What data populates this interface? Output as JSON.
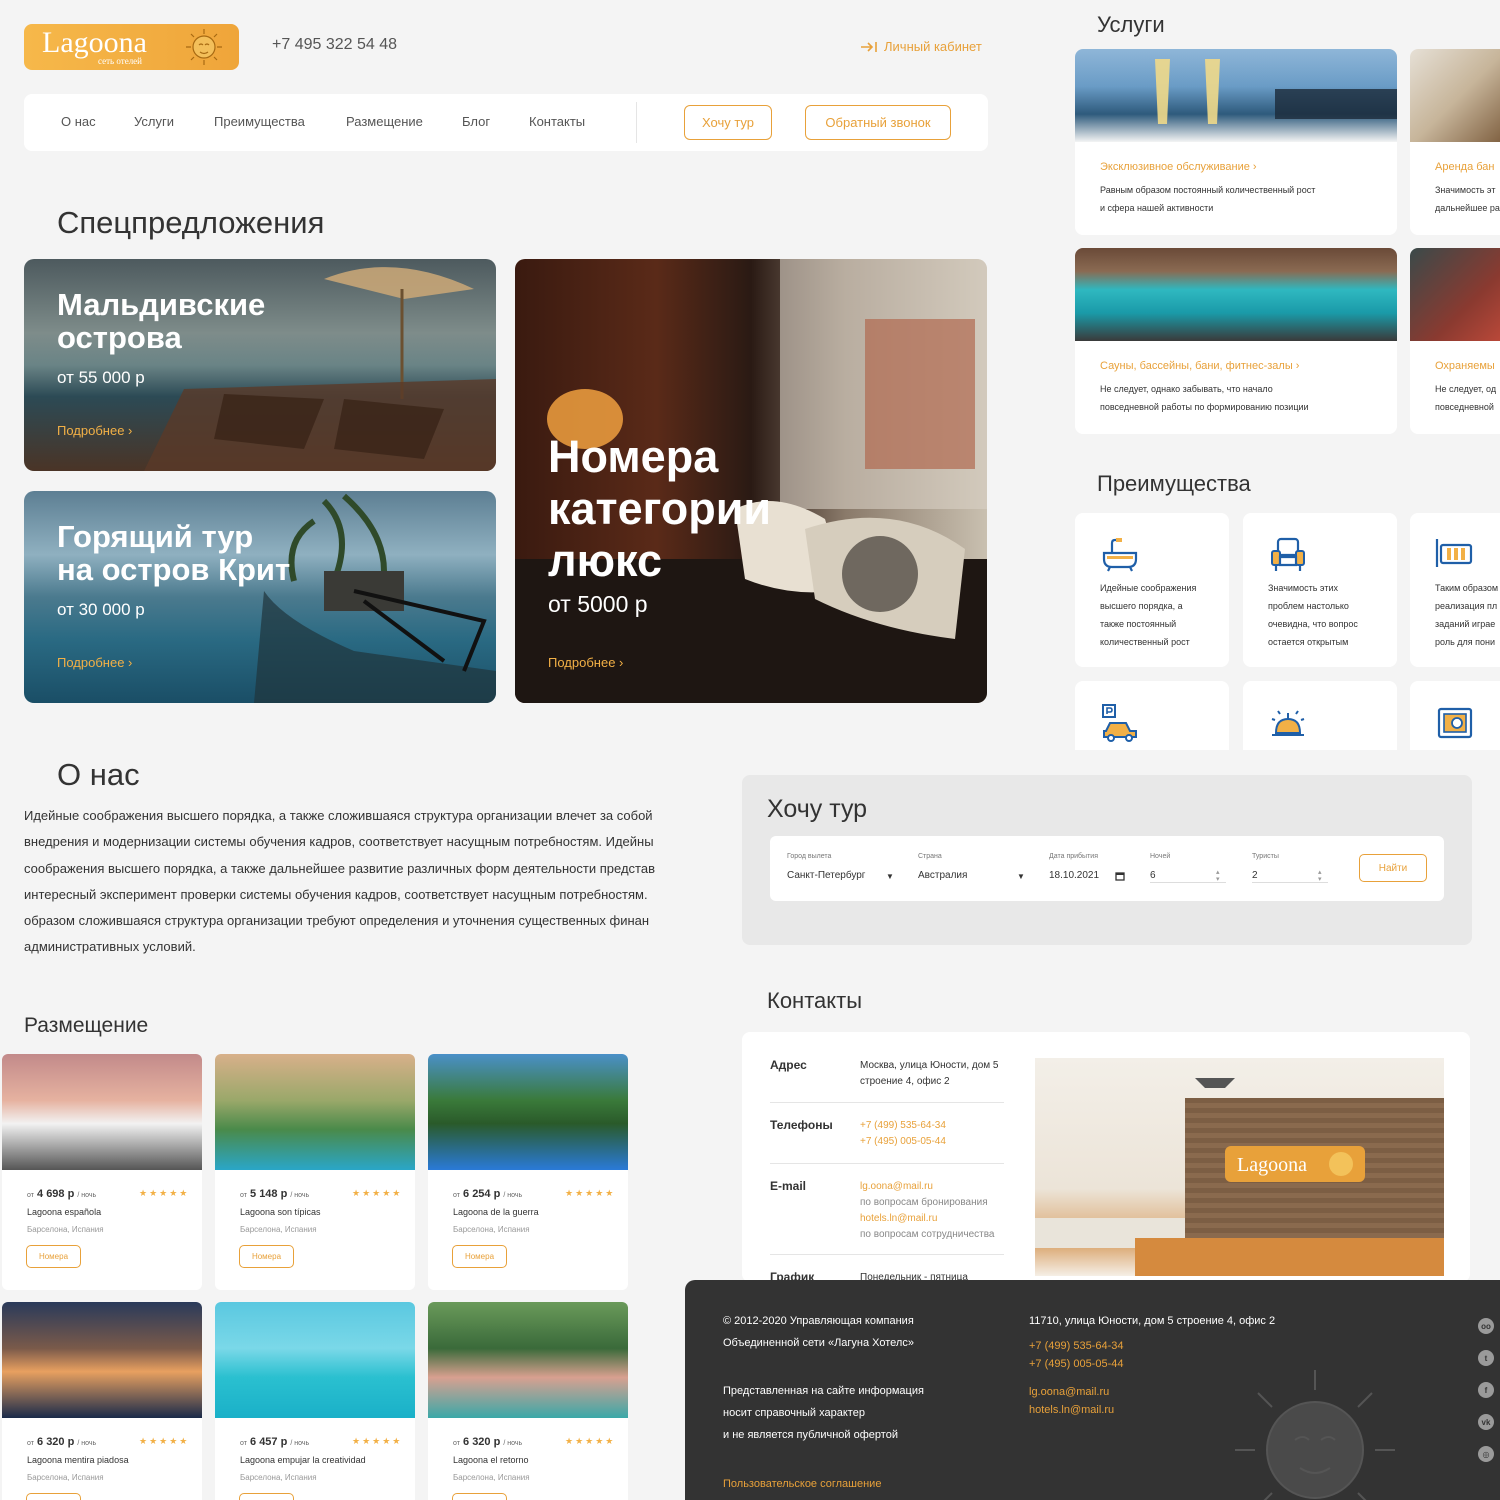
{
  "brand": {
    "name": "Lagoona",
    "tagline": "сеть отелей",
    "accent": "#e8a13a"
  },
  "header": {
    "phone": "+7 495 322 54 48",
    "cabinet": "Личный кабинет",
    "cabinet_icon": "login-arrow-icon"
  },
  "nav": {
    "items": [
      "О нас",
      "Услуги",
      "Преимущества",
      "Размещение",
      "Блог",
      "Контакты"
    ],
    "want_tour": "Хочу тур",
    "callback": "Обратный звонок"
  },
  "offers": {
    "heading": "Спецпредложения",
    "items": [
      {
        "title1": "Мальдивские",
        "title2": "острова",
        "price": "от 55 000 р",
        "more": "Подробнее"
      },
      {
        "title1": "Горящий тур",
        "title2": "на остров Крит",
        "price": "от 30 000 р",
        "more": "Подробнее"
      },
      {
        "title1": "Номера",
        "title2": "категории",
        "title3": "люкс",
        "price": "от 5000 р",
        "more": "Подробнее"
      }
    ]
  },
  "services": {
    "heading": "Услуги",
    "items": [
      {
        "title": "Эксклюзивное обслуживание",
        "line1": "Равным образом постоянный количественный рост",
        "line2": "и сфера нашей активности"
      },
      {
        "title": "Аренда бан",
        "line1": "Значимость эт",
        "line2": "дальнейшее ра"
      },
      {
        "title": "Сауны, бассейны, бани, фитнес-залы",
        "line1": "Не следует, однако забывать, что начало",
        "line2": "повседневной работы по формированию позиции"
      },
      {
        "title": "Охраняемы",
        "line1": "Не следует, од",
        "line2": "повседневной"
      }
    ]
  },
  "advantages": {
    "heading": "Преимущества",
    "items": [
      {
        "icon": "bathtub-icon",
        "lines": [
          "Идейные соображения",
          "высшего порядка, а",
          "также постоянный",
          "количественный рост"
        ]
      },
      {
        "icon": "armchair-icon",
        "lines": [
          "Значимость этих",
          "проблем настолько",
          "очевидна, что вопрос",
          "остается открытым"
        ]
      },
      {
        "icon": "radiator-icon",
        "lines": [
          "Таким образом",
          "реализация пл",
          "заданий играе",
          "роль для пони"
        ]
      },
      {
        "icon": "parking-car-icon",
        "lines": []
      },
      {
        "icon": "service-bell-icon",
        "lines": []
      },
      {
        "icon": "safe-icon",
        "lines": []
      }
    ]
  },
  "about": {
    "heading": "О нас",
    "lines": [
      "Идейные соображения высшего порядка, а также сложившаяся структура организации влечет за собой",
      "внедрения и модернизации системы обучения кадров, соответствует насущным потребностям. Идейны",
      "соображения высшего порядка, а также дальнейшее развитие различных форм деятельности представ",
      "интересный эксперимент проверки системы обучения кадров, соответствует насущным потребностям. ",
      "образом сложившаяся структура организации требуют определения и уточнения существенных финан",
      "административных условий."
    ]
  },
  "tour": {
    "heading": "Хочу тур",
    "fields": [
      {
        "label": "Город вылета",
        "value": "Санкт-Петербург",
        "icon": "dropdown-caret-icon"
      },
      {
        "label": "Страна",
        "value": "Австралия",
        "icon": "dropdown-caret-icon"
      },
      {
        "label": "Дата прибытия",
        "value": "18.10.2021",
        "icon": "calendar-icon"
      },
      {
        "label": "Ночей",
        "value": "6",
        "icon": "stepper-icon"
      },
      {
        "label": "Туристы",
        "value": "2",
        "icon": "stepper-icon"
      }
    ],
    "find": "Найти"
  },
  "contacts": {
    "heading": "Контакты",
    "address_label": "Адрес",
    "address": [
      "Москва, улица Юности, дом 5",
      "строение 4, офис 2"
    ],
    "phones_label": "Телефоны",
    "phones": [
      "+7 (499) 535-64-34",
      "+7 (495) 005-05-44"
    ],
    "email_label": "E-mail",
    "email1": "lg.oona@mail.ru",
    "email1_note": "по вопросам бронирования",
    "email2": "hotels.ln@mail.ru",
    "email2_note": "по вопросам сотрудничества",
    "schedule_label": "График",
    "schedule": "Понедельник - пятница"
  },
  "accommodation": {
    "heading": "Размещение",
    "from": "от",
    "per_night": "/ ночь",
    "button": "Номера",
    "stars": "★★★★★",
    "items": [
      {
        "price": "4 698 р",
        "name": "Lagoona española",
        "location": "Барселона, Испания"
      },
      {
        "price": "5 148 р",
        "name": "Lagoona son típicas",
        "location": "Барселона, Испания"
      },
      {
        "price": "6 254 р",
        "name": "Lagoona de la guerra",
        "location": "Барселона, Испания"
      },
      {
        "price": "6 320 р",
        "name": "Lagoona mentira piadosa",
        "location": "Барселона, Испания"
      },
      {
        "price": "6 457 р",
        "name": "Lagoona empujar la creatividad",
        "location": "Барселона, Испания"
      },
      {
        "price": "6 320 р",
        "name": "Lagoona el retorno",
        "location": "Барселона, Испания"
      }
    ]
  },
  "footer": {
    "copyright1": "© 2012-2020 Управляющая компания",
    "copyright2": "Объединенной сети «Лагуна Хотелс»",
    "info1": "Представленная на сайте информация",
    "info2": "носит справочный характер",
    "info3": "и не является публичной офертой",
    "agreement": "Пользовательское соглашение",
    "address": "11710, улица Юности, дом 5 строение 4, офис 2",
    "phone1": "+7 (499) 535-64-34",
    "phone2": "+7 (495) 005-05-44",
    "email1": "lg.oona@mail.ru",
    "email2": "hotels.ln@mail.ru",
    "socials": [
      "tripadvisor-icon",
      "twitter-icon",
      "facebook-icon",
      "vk-icon",
      "instagram-icon"
    ]
  }
}
